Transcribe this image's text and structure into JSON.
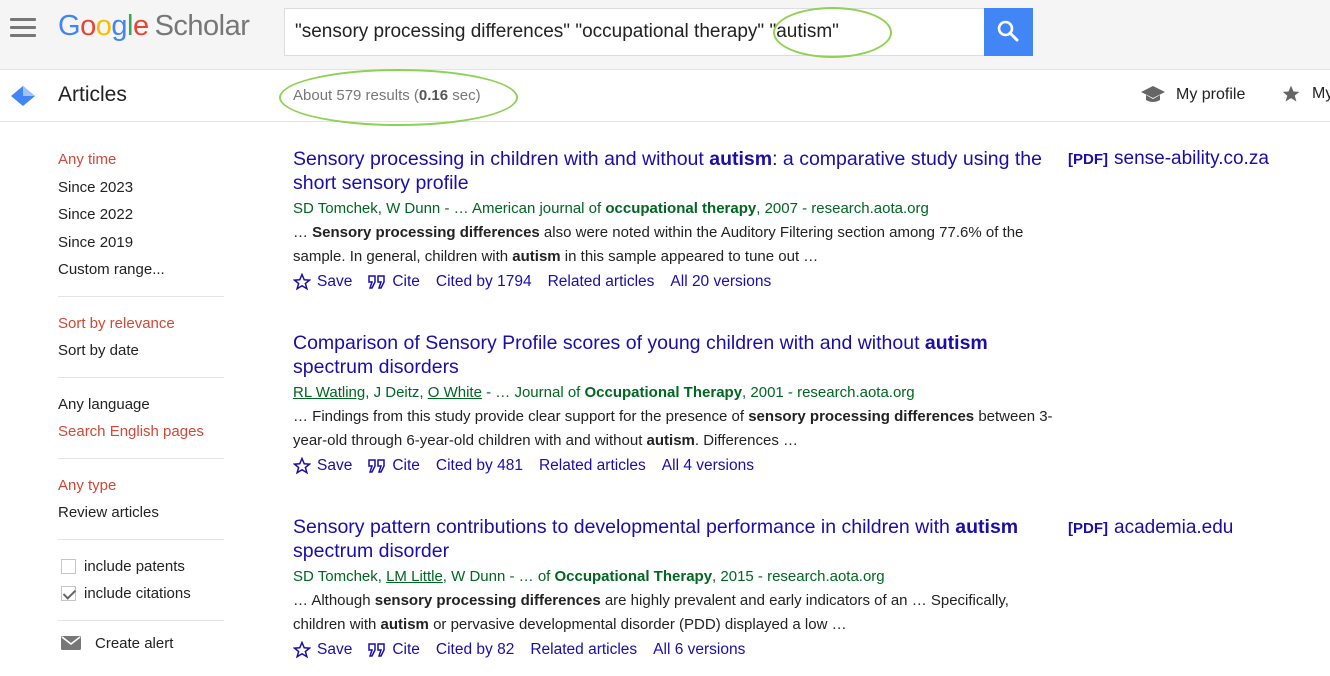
{
  "header": {
    "logo_google": [
      "G",
      "o",
      "o",
      "g",
      "l",
      "e"
    ],
    "logo_scholar": "Scholar",
    "search_query": "\"sensory processing differences\" \"occupational therapy\" \"autism\"",
    "search_button_icon": "search-icon"
  },
  "subbar": {
    "section_label": "Articles",
    "results_prefix": "About 579 results (",
    "results_time": "0.16",
    "results_suffix": " sec)",
    "my_profile": "My profile",
    "my_library": "My library"
  },
  "sidebar": {
    "time_filters": [
      {
        "label": "Any time",
        "active": true
      },
      {
        "label": "Since 2023",
        "active": false
      },
      {
        "label": "Since 2022",
        "active": false
      },
      {
        "label": "Since 2019",
        "active": false
      },
      {
        "label": "Custom range...",
        "active": false
      }
    ],
    "sort_filters": [
      {
        "label": "Sort by relevance",
        "active": true
      },
      {
        "label": "Sort by date",
        "active": false
      }
    ],
    "language_filters": [
      {
        "label": "Any language",
        "active": false
      },
      {
        "label": "Search English pages",
        "active": true
      }
    ],
    "type_filters": [
      {
        "label": "Any type",
        "active": true
      },
      {
        "label": "Review articles",
        "active": false
      }
    ],
    "include_patents": {
      "label": "include patents",
      "checked": false
    },
    "include_citations": {
      "label": "include citations",
      "checked": true
    },
    "create_alert": "Create alert"
  },
  "results": [
    {
      "title_parts": [
        {
          "text": "Sensory processing in children with and without ",
          "bold": false
        },
        {
          "text": "autism",
          "bold": true
        },
        {
          "text": ": a comparative study using the short sensory profile",
          "bold": false
        }
      ],
      "meta_parts": [
        {
          "text": "SD Tomchek, W Dunn",
          "bold": false,
          "underline": false
        },
        {
          "text": " - … American journal of ",
          "bold": false,
          "underline": false
        },
        {
          "text": "occupational therapy",
          "bold": true,
          "underline": false
        },
        {
          "text": ", 2007 - research.aota.org",
          "bold": false,
          "underline": false
        }
      ],
      "snippet_parts": [
        {
          "text": "… ",
          "bold": false
        },
        {
          "text": "Sensory processing differences",
          "bold": true
        },
        {
          "text": " also were noted within the Auditory Filtering section among 77.6% of the sample. In general, children with ",
          "bold": false
        },
        {
          "text": "autism",
          "bold": true
        },
        {
          "text": " in this sample appeared to tune out …",
          "bold": false
        }
      ],
      "save": "Save",
      "cite": "Cite",
      "cited_by": "Cited by 1794",
      "related": "Related articles",
      "versions": "All 20 versions",
      "pdf_tag": "[PDF]",
      "pdf_source": "sense-ability.co.za"
    },
    {
      "title_parts": [
        {
          "text": "Comparison of Sensory Profile scores of young children with and without ",
          "bold": false
        },
        {
          "text": "autism",
          "bold": true
        },
        {
          "text": " spectrum disorders",
          "bold": false
        }
      ],
      "meta_parts": [
        {
          "text": "RL Watling",
          "bold": false,
          "underline": true
        },
        {
          "text": ", J Deitz, ",
          "bold": false,
          "underline": false
        },
        {
          "text": "O White",
          "bold": false,
          "underline": true
        },
        {
          "text": " - … Journal of ",
          "bold": false,
          "underline": false
        },
        {
          "text": "Occupational Therapy",
          "bold": true,
          "underline": false
        },
        {
          "text": ", 2001 - research.aota.org",
          "bold": false,
          "underline": false
        }
      ],
      "snippet_parts": [
        {
          "text": "… Findings from this study provide clear support for the presence of ",
          "bold": false
        },
        {
          "text": "sensory processing differences",
          "bold": true
        },
        {
          "text": " between 3-year-old through 6-year-old children with and without ",
          "bold": false
        },
        {
          "text": "autism",
          "bold": true
        },
        {
          "text": ". Differences …",
          "bold": false
        }
      ],
      "save": "Save",
      "cite": "Cite",
      "cited_by": "Cited by 481",
      "related": "Related articles",
      "versions": "All 4 versions",
      "pdf_tag": "",
      "pdf_source": ""
    },
    {
      "title_parts": [
        {
          "text": "Sensory pattern contributions to developmental performance in children with ",
          "bold": false
        },
        {
          "text": "autism",
          "bold": true
        },
        {
          "text": " spectrum disorder",
          "bold": false
        }
      ],
      "meta_parts": [
        {
          "text": "SD Tomchek, ",
          "bold": false,
          "underline": false
        },
        {
          "text": "LM Little",
          "bold": false,
          "underline": true
        },
        {
          "text": ", W Dunn - … of ",
          "bold": false,
          "underline": false
        },
        {
          "text": "Occupational Therapy",
          "bold": true,
          "underline": false
        },
        {
          "text": ", 2015 - research.aota.org",
          "bold": false,
          "underline": false
        }
      ],
      "snippet_parts": [
        {
          "text": "… Although ",
          "bold": false
        },
        {
          "text": "sensory processing differences",
          "bold": true
        },
        {
          "text": " are highly prevalent and early indicators of an … Specifically, children with ",
          "bold": false
        },
        {
          "text": "autism",
          "bold": true
        },
        {
          "text": " or pervasive developmental disorder (PDD) displayed a low …",
          "bold": false
        }
      ],
      "save": "Save",
      "cite": "Cite",
      "cited_by": "Cited by 82",
      "related": "Related articles",
      "versions": "All 6 versions",
      "pdf_tag": "[PDF]",
      "pdf_source": "academia.edu"
    }
  ],
  "colors": {
    "link_blue": "#1a0dab",
    "meta_green": "#006621",
    "active_red": "#d14836",
    "annotation_green": "#8fd155",
    "search_blue": "#4285f4"
  }
}
